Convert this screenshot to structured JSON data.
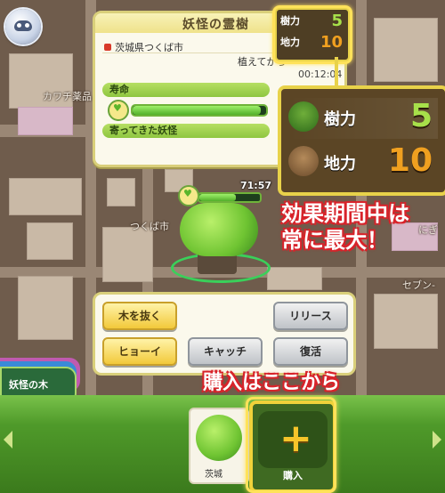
{
  "map": {
    "labels": {
      "kawachi": "カワチ薬品",
      "tsukuba": "つくば市",
      "seven": "セブン-",
      "park_hint": "にぎ"
    }
  },
  "panel": {
    "title": "妖怪の霊樹",
    "location": "茨城県つくば市",
    "planted_label": "植えてから",
    "planted_time": "00:12:04",
    "life_label": "寿命",
    "visitors_label": "寄ってきた妖怪",
    "life_level": 0.96
  },
  "stats": {
    "tree_power_label": "樹力",
    "tree_power_value": "5",
    "land_power_label": "地力",
    "land_power_value": "10"
  },
  "callouts": {
    "effect_line1": "効果期間中は",
    "effect_line2": "常に最大！",
    "buy_here": "購入はここから"
  },
  "tree": {
    "time": "71:57",
    "life_level": 0.6
  },
  "actions": {
    "pull": "木を抜く",
    "release": "リリース",
    "hyoi": "ヒョーイ",
    "catch": "キャッチ",
    "revive": "復活"
  },
  "sidetab": {
    "label": "妖怪の木"
  },
  "bottom": {
    "thumb_label": "茨城",
    "buy_label": "購入",
    "buy_plus": "+"
  },
  "colors": {
    "accent_gold": "#e8d24a",
    "callout_red": "#d8232a",
    "bar_green": "#52b02a"
  }
}
